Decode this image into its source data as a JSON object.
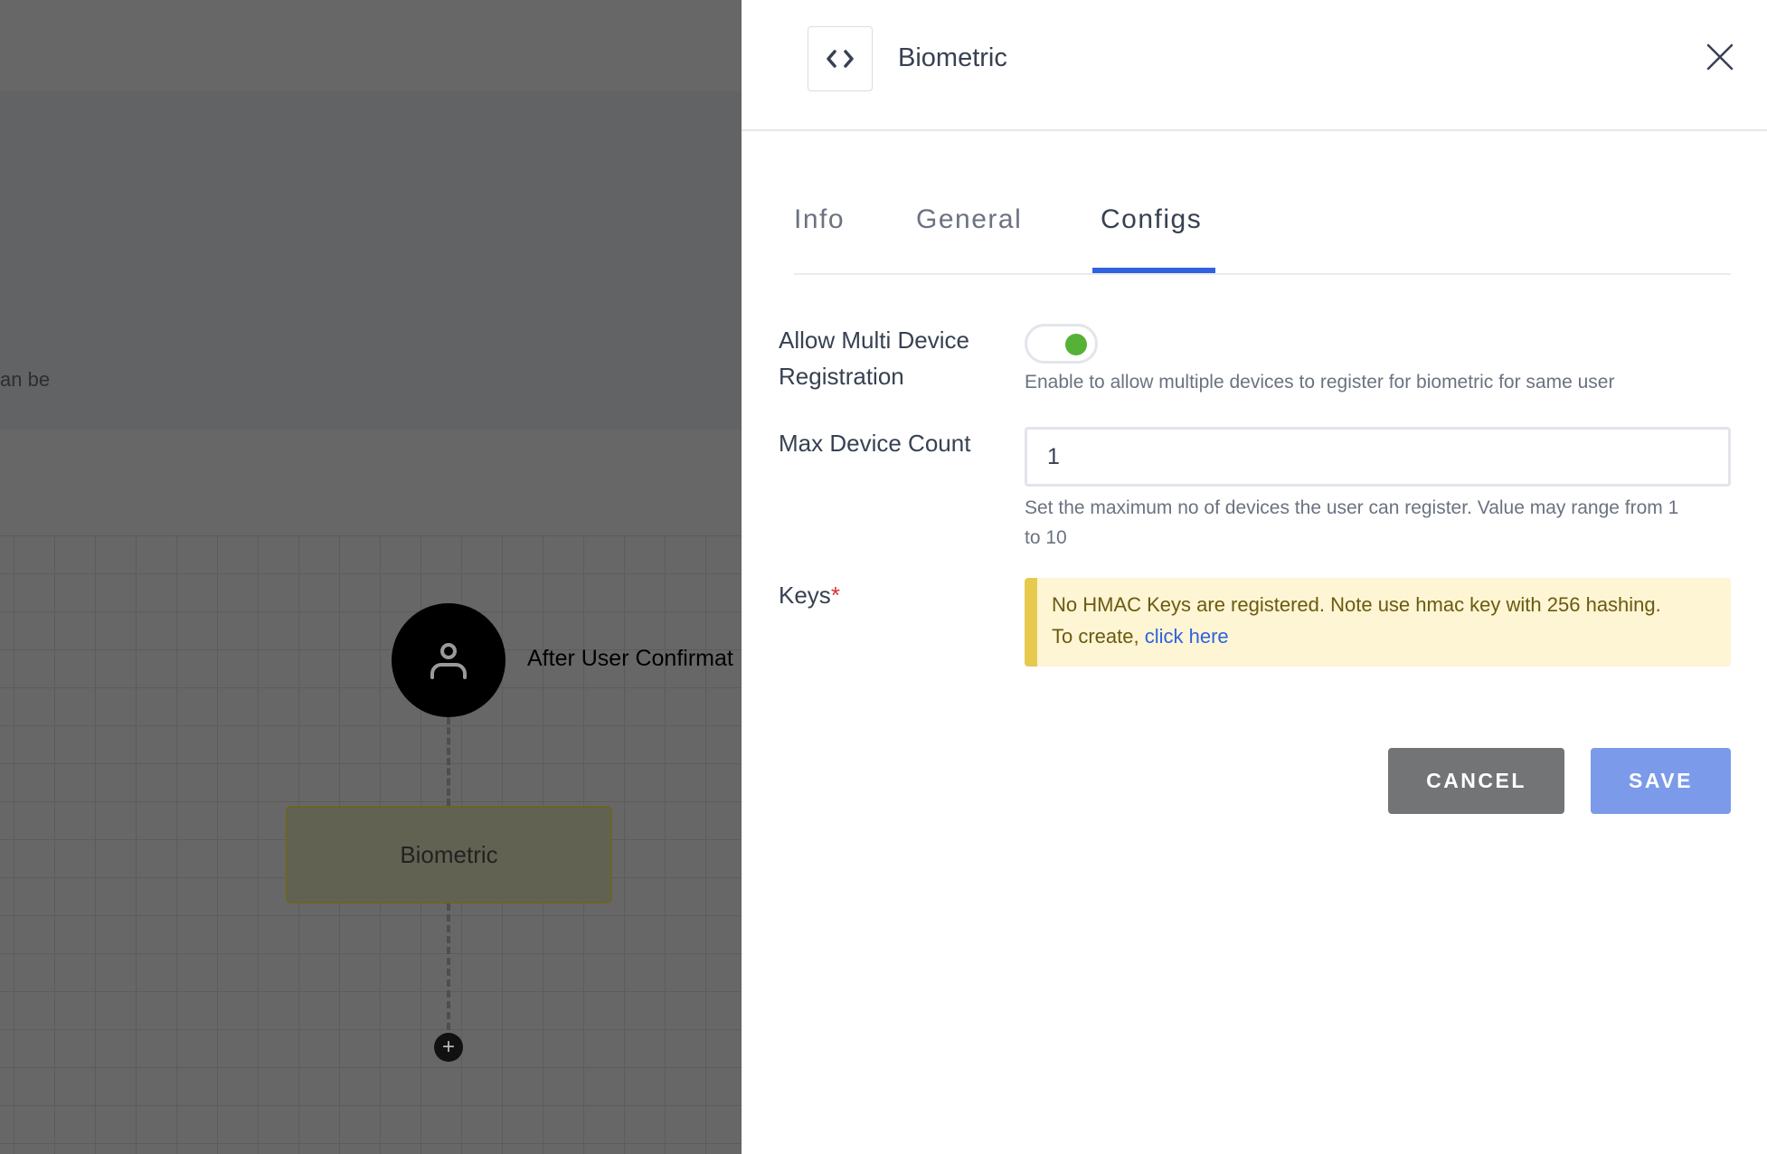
{
  "canvas": {
    "info_fragment": "an be",
    "user_node_label": "After User Confirmat",
    "biometric_node_label": "Biometric",
    "add_node_symbol": "+"
  },
  "panel": {
    "title": "Biometric",
    "code_icon": "code-brackets-icon",
    "close_icon": "close-x-icon",
    "tabs": [
      {
        "label": "Info",
        "active": false
      },
      {
        "label": "General",
        "active": false
      },
      {
        "label": "Configs",
        "active": true
      }
    ],
    "fields": {
      "multi_device": {
        "label_line1": "Allow Multi Device",
        "label_line2": "Registration",
        "enabled": true,
        "help": "Enable to allow multiple devices to register for biometric for same user"
      },
      "max_device_count": {
        "label": "Max Device Count",
        "value": "1",
        "help_line1": "Set the maximum no of devices the user can register. Value may range from 1",
        "help_line2": "to 10"
      },
      "keys": {
        "label": "Keys",
        "required_mark": "*",
        "alert_line1": "No HMAC Keys are registered. Note use hmac key with 256 hashing.",
        "alert_prefix": "To create, ",
        "alert_link": "click here"
      }
    },
    "buttons": {
      "cancel": "CANCEL",
      "save": "SAVE"
    }
  },
  "colors": {
    "accent": "#2f62de",
    "toggle_on": "#55b236",
    "alert_bg": "#fdf5d3",
    "alert_border": "#e7c94e",
    "required": "#d9342b"
  }
}
